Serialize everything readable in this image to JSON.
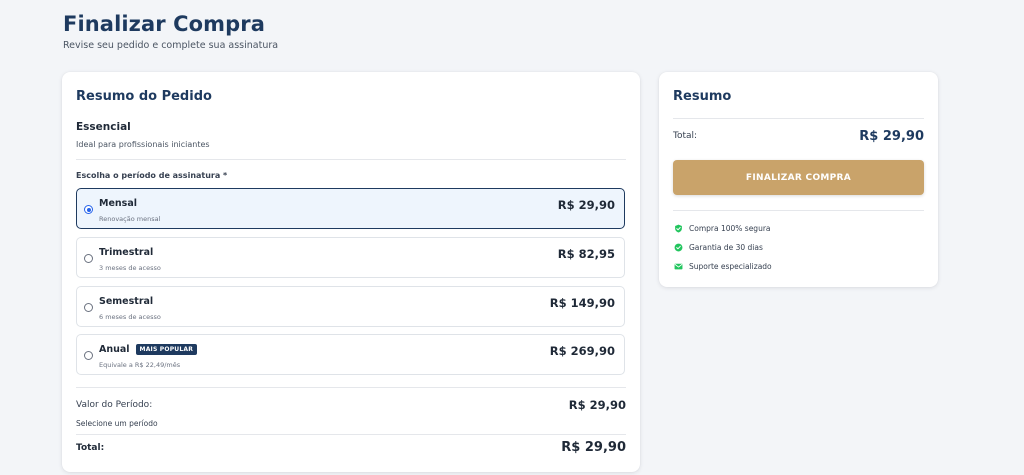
{
  "header": {
    "title": "Finalizar Compra",
    "subtitle": "Revise seu pedido e complete sua assinatura"
  },
  "order": {
    "title": "Resumo do Pedido",
    "plan_name": "Essencial",
    "plan_description": "Ideal para profissionais iniciantes",
    "period_label": "Escolha o período de assinatura *",
    "options": [
      {
        "name": "Mensal",
        "note": "Renovação mensal",
        "price": "R$ 29,90",
        "badge": "",
        "selected": true
      },
      {
        "name": "Trimestral",
        "note": "3 meses de acesso",
        "price": "R$ 82,95",
        "badge": "",
        "selected": false
      },
      {
        "name": "Semestral",
        "note": "6 meses de acesso",
        "price": "R$ 149,90",
        "badge": "",
        "selected": false
      },
      {
        "name": "Anual",
        "note": "Equivale a R$ 22,49/mês",
        "price": "R$ 269,90",
        "badge": "MAIS POPULAR",
        "selected": false
      }
    ],
    "period_value_label": "Valor do Período:",
    "period_value": "R$ 29,90",
    "period_hint": "Selecione um período",
    "total_label": "Total:",
    "total_value": "R$ 29,90"
  },
  "summary": {
    "title": "Resumo",
    "total_label": "Total:",
    "total_value": "R$ 29,90",
    "button_label": "FINALIZAR COMPRA",
    "features": [
      {
        "icon": "shield-check-icon",
        "text": "Compra 100% segura"
      },
      {
        "icon": "check-circle-icon",
        "text": "Garantia de 30 dias"
      },
      {
        "icon": "envelope-icon",
        "text": "Suporte especializado"
      }
    ]
  },
  "colors": {
    "primary": "#1e3a5f",
    "accent": "#c9a36a",
    "success": "#22c55e",
    "selected_bg": "#eef5fd"
  }
}
